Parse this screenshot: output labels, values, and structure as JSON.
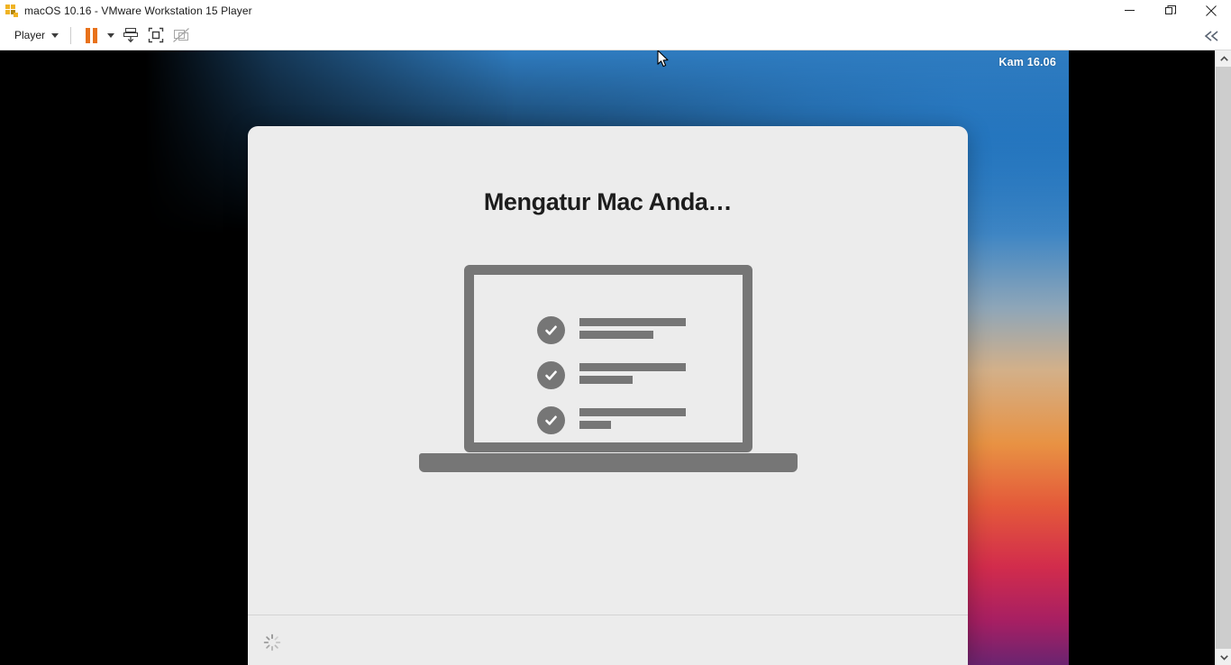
{
  "window": {
    "title": "macOS 10.16 - VMware Workstation 15 Player",
    "app_icon": "vmware-logo-icon",
    "controls": {
      "minimize": "minimize-icon",
      "restore": "restore-icon",
      "close": "close-icon"
    }
  },
  "toolbar": {
    "player_menu_label": "Player",
    "player_menu_caret": "chevron-down-icon",
    "buttons": [
      {
        "name": "pause-vm",
        "icon": "pause-icon",
        "enabled": true
      },
      {
        "name": "pause-dropdown",
        "icon": "chevron-down-icon",
        "enabled": true
      },
      {
        "name": "send-key",
        "icon": "send-ctrl-alt-del-icon",
        "enabled": true
      },
      {
        "name": "full-screen",
        "icon": "fullscreen-icon",
        "enabled": true
      },
      {
        "name": "unity-mode",
        "icon": "unity-mode-disabled-icon",
        "enabled": false
      }
    ],
    "collapse_label": "collapse-toolbar-icon"
  },
  "guest": {
    "menubar": {
      "clock": "Kam 16.06"
    },
    "wallpaper": {
      "name": "big-sur-gradient",
      "colors": [
        "#6d8fc9",
        "#d93a35",
        "#cf2140",
        "#331a5e",
        "#12245c",
        "#1668b8",
        "#e89243",
        "#a61f63"
      ]
    },
    "cursor": "arrow-cursor",
    "dialog": {
      "title": "Mengatur Mac Anda…",
      "illustration": {
        "name": "laptop-checklist-illustration",
        "accent": "#767676",
        "rows": [
          {
            "icon": "check-circle-icon",
            "bar_long": 118,
            "bar_short": 82
          },
          {
            "icon": "check-circle-icon",
            "bar_long": 118,
            "bar_short": 59
          },
          {
            "icon": "check-circle-icon",
            "bar_long": 118,
            "bar_short": 35
          }
        ]
      },
      "footer": {
        "spinner": "loading-spinner-icon"
      }
    }
  },
  "scrollbar": {
    "up_arrow": "scroll-up-icon",
    "down_arrow": "scroll-down-icon"
  }
}
